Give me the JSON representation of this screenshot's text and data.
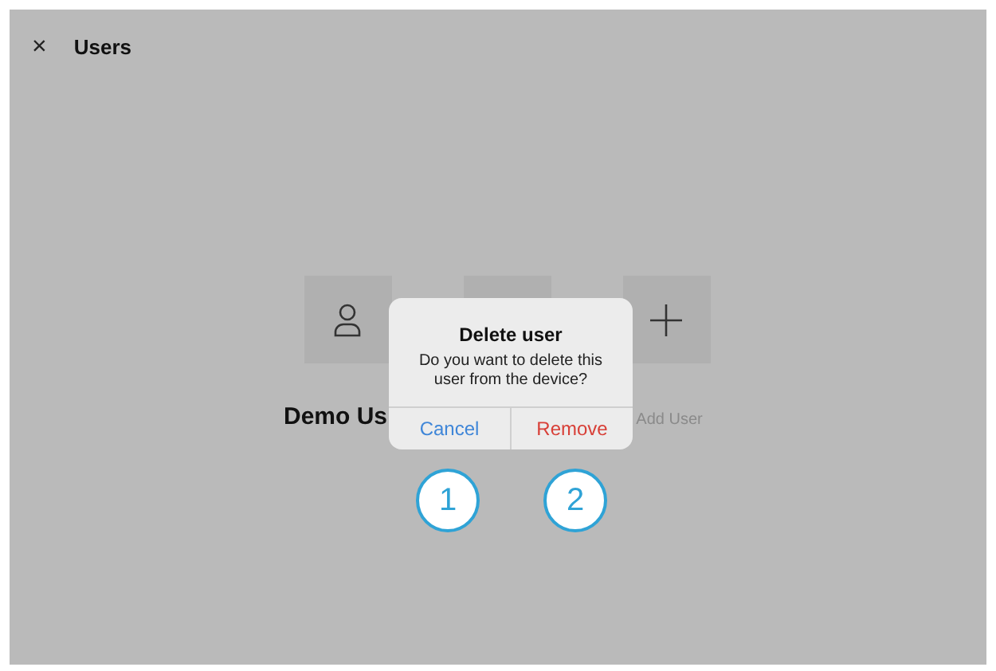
{
  "header": {
    "close": "×",
    "title": "Users"
  },
  "users": [
    {
      "kind": "user",
      "label": "Demo Us"
    },
    {
      "kind": "blank"
    },
    {
      "kind": "add",
      "label": "Add User"
    }
  ],
  "dialog": {
    "title": "Delete user",
    "message": "Do you want to delete this user from the device?",
    "buttons": [
      {
        "label": "Cancel",
        "kind": "cancel"
      },
      {
        "label": "Remove",
        "kind": "destructive"
      }
    ]
  },
  "callouts": [
    "1",
    "2"
  ]
}
